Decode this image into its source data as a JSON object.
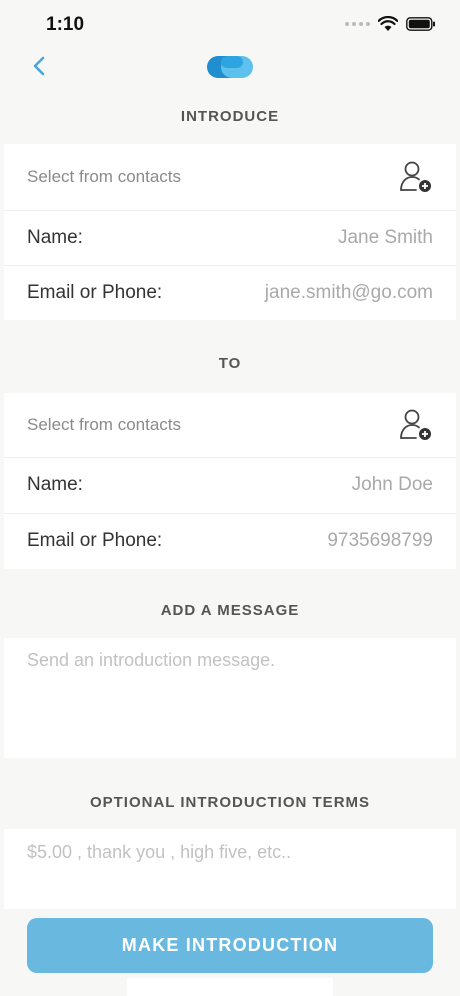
{
  "status": {
    "time": "1:10"
  },
  "colors": {
    "accent": "#68b8e0",
    "back_chevron": "#4aa6d6",
    "logo_dark": "#1f8fd0",
    "logo_light": "#5ec0ec"
  },
  "icons": {
    "back": "chevron-left-icon",
    "add_contact": "add-contact-icon",
    "logo": "app-logo-icon"
  },
  "introduce": {
    "title": "INTRODUCE",
    "select_label": "Select from contacts",
    "name_label": "Name:",
    "name_value": "Jane Smith",
    "contact_label": "Email or Phone:",
    "contact_value": "jane.smith@go.com"
  },
  "to": {
    "title": "TO",
    "select_label": "Select from contacts",
    "name_label": "Name:",
    "name_value": "John Doe",
    "contact_label": "Email or Phone:",
    "contact_value": "9735698799"
  },
  "message": {
    "title": "ADD A MESSAGE",
    "placeholder": "Send an introduction message."
  },
  "terms": {
    "title": "OPTIONAL INTRODUCTION TERMS",
    "placeholder": "$5.00 , thank you , high five, etc.."
  },
  "cta": {
    "label": "MAKE INTRODUCTION"
  }
}
